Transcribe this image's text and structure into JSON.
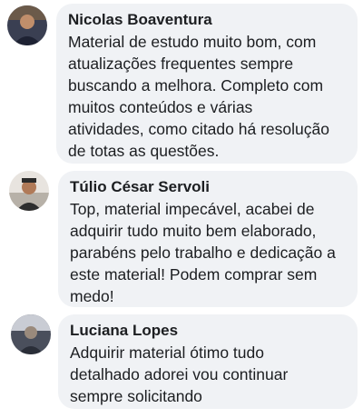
{
  "comments": [
    {
      "author": "Nicolas Boaventura",
      "lines": [
        "Material de estudo muito bom, com",
        "atualizações frequentes sempre",
        "buscando a melhora. Completo com",
        "muitos conteúdos e várias",
        "atividades, como citado há resolução",
        "de totas as questões."
      ]
    },
    {
      "author": "Túlio César Servoli",
      "lines": [
        "Top, material impecável, acabei de",
        "adquirir tudo muito bem elaborado,",
        "parabéns pelo trabalho e dedicação a",
        "este material! Podem comprar sem",
        "medo!"
      ]
    },
    {
      "author": "Luciana Lopes",
      "lines": [
        "Adquirir material ótimo tudo",
        "detalhado adorei vou continuar",
        "sempre solicitando"
      ]
    }
  ],
  "colors": {
    "bubble": "#f0f2f5",
    "text": "#1c1e21"
  }
}
